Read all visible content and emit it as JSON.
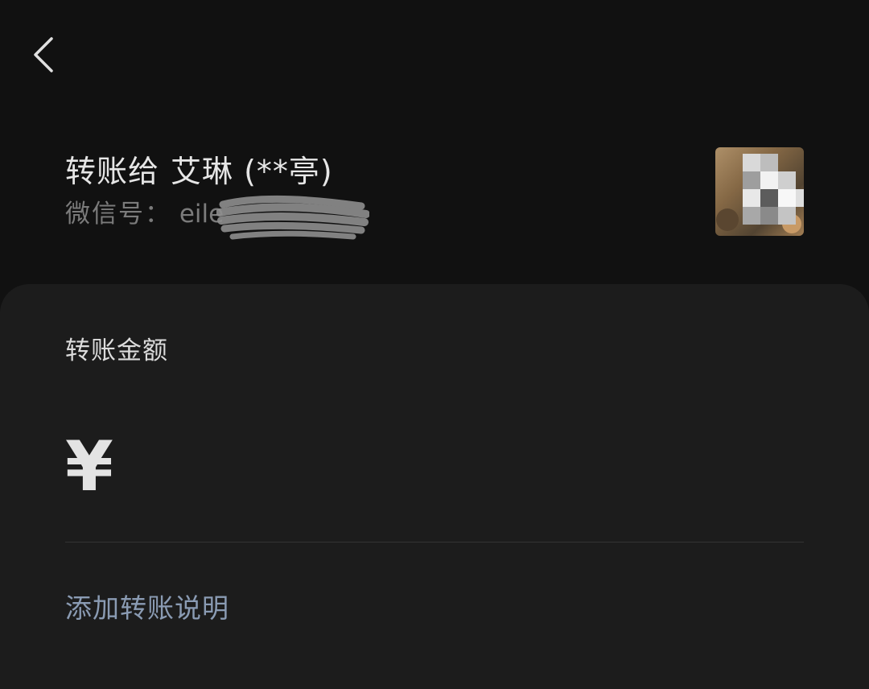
{
  "nav": {
    "back_icon": "chevron-left-icon"
  },
  "recipient": {
    "prefix": "转账给",
    "name": "艾琳 (**亭)",
    "wechat_id_label": "微信号：",
    "wechat_id_visible": "eile",
    "avatar_icon": "pixelated-avatar"
  },
  "transfer": {
    "amount_label": "转账金额",
    "currency_symbol": "¥",
    "amount_value": "",
    "add_note_link": "添加转账说明"
  },
  "colors": {
    "background": "#111111",
    "panel": "#1c1c1c",
    "primary_text": "#e6e6e6",
    "secondary_text": "#7b7b7b",
    "link": "#8a9bb3"
  }
}
